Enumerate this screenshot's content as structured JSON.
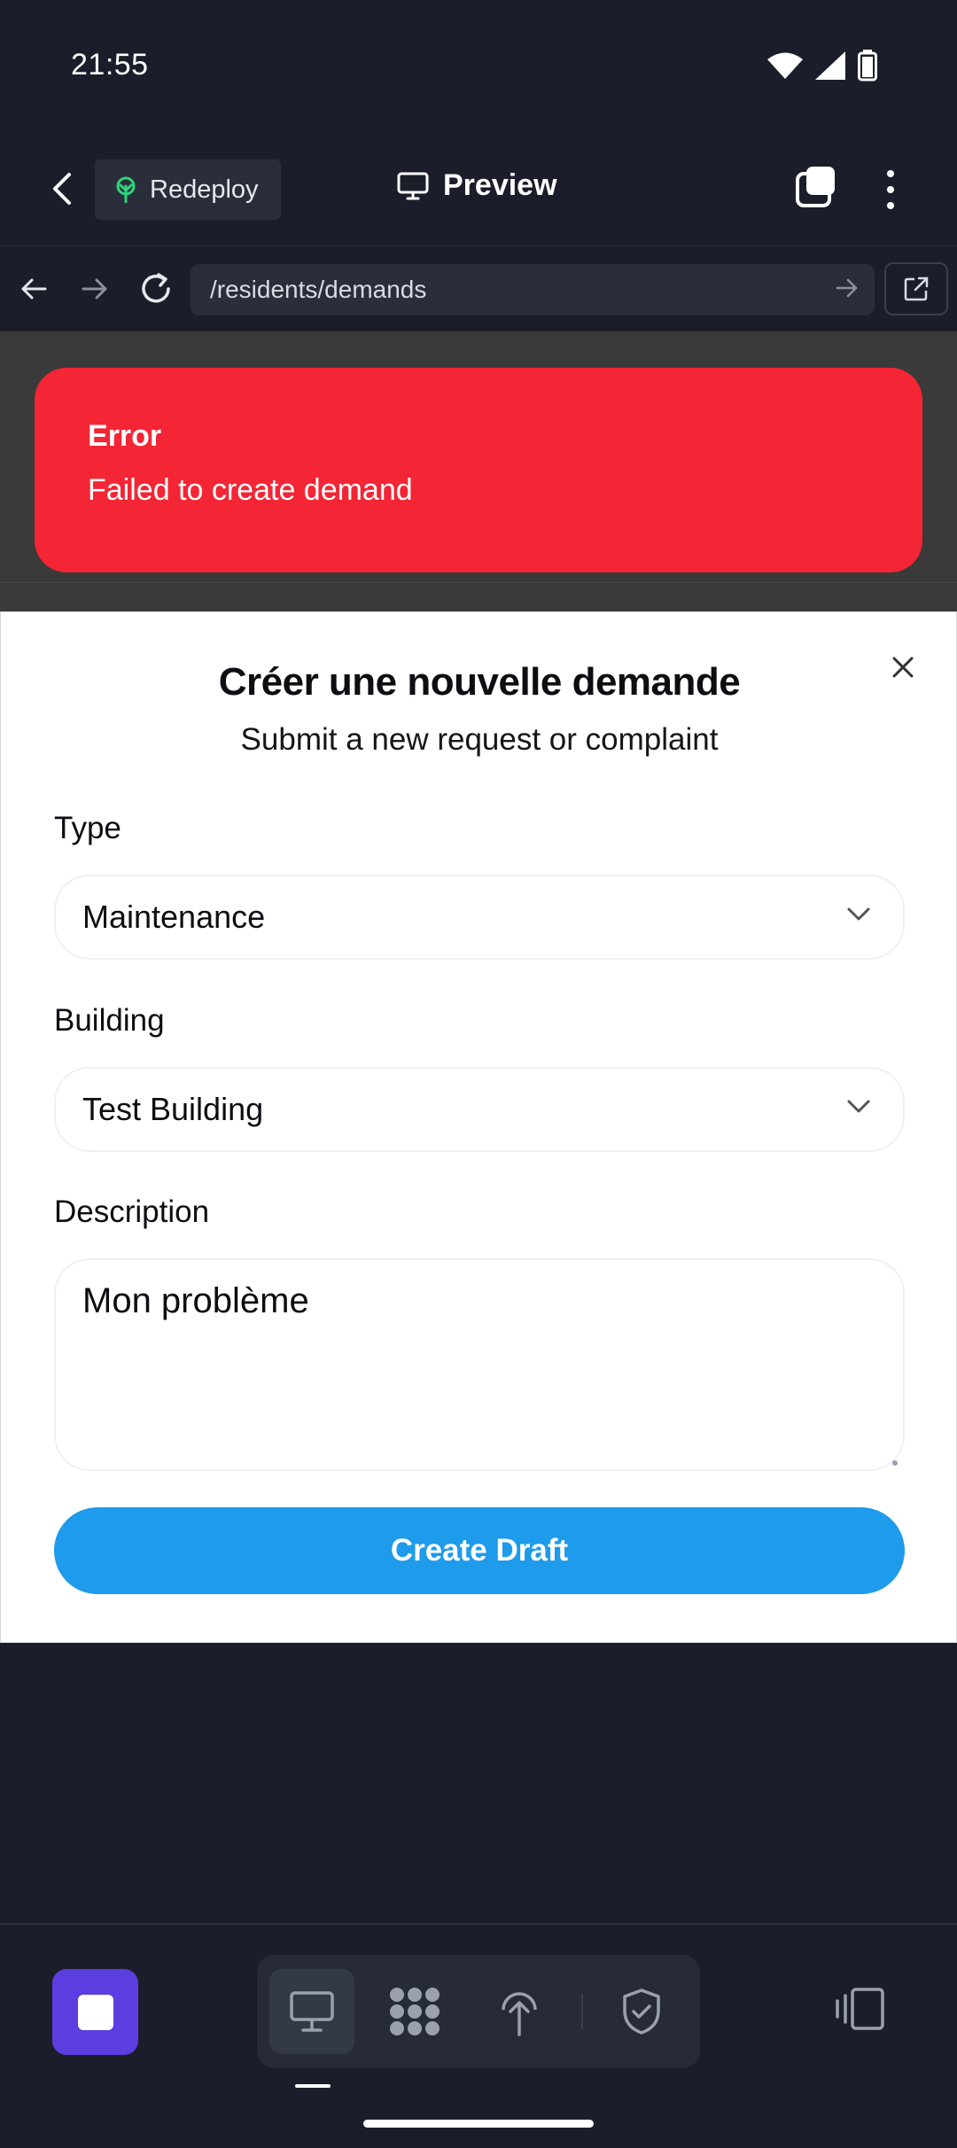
{
  "status_bar": {
    "time": "21:55",
    "icons": [
      "wifi-icon",
      "signal-icon",
      "battery-icon"
    ]
  },
  "header": {
    "redeploy_label": "Redeploy",
    "preview_label": "Preview",
    "icons": [
      "back-icon",
      "tree-icon",
      "monitor-icon",
      "tabs-icon",
      "more-vertical-icon"
    ]
  },
  "url_bar": {
    "url": "/residents/demands"
  },
  "toast": {
    "title": "Error",
    "message": "Failed to create demand",
    "color": "#f42534"
  },
  "dialog": {
    "title": "Créer une nouvelle demande",
    "subtitle": "Submit a new request or complaint",
    "type_label": "Type",
    "type_value": "Maintenance",
    "building_label": "Building",
    "building_value": "Test Building",
    "description_label": "Description",
    "description_value": "Mon problème",
    "submit_label": "Create Draft",
    "accent": "#1e9bea"
  },
  "bottom_toolbar": {
    "tools": [
      "desktop-icon",
      "grid-dots-icon",
      "deploy-icon",
      "shield-check-icon"
    ],
    "active_tool": "desktop-icon",
    "app_color": "#5b3de0"
  }
}
